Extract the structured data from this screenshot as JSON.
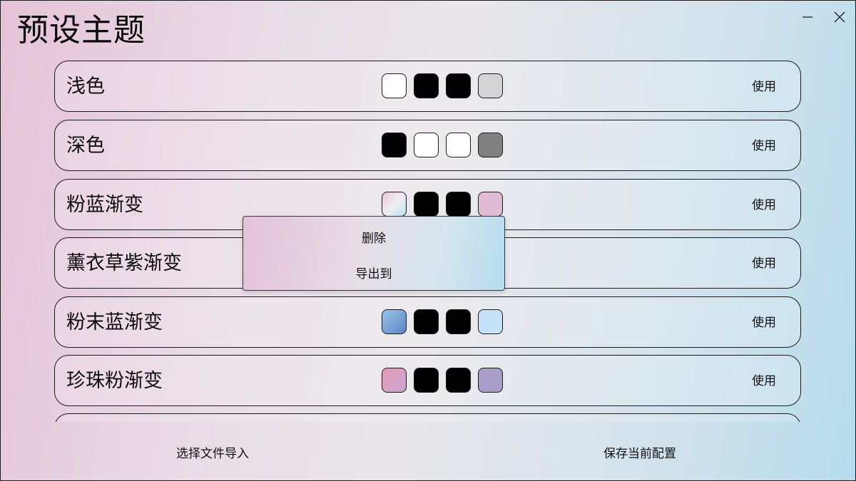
{
  "window": {
    "title": "预设主题",
    "controls": {
      "minimize": "minimize-icon",
      "close": "close-icon"
    }
  },
  "themes": [
    {
      "name": "浅色",
      "use_label": "使用",
      "swatches": [
        "#ffffff",
        "#000000",
        "#000000",
        "#d4d4d4"
      ]
    },
    {
      "name": "深色",
      "use_label": "使用",
      "swatches": [
        "#000000",
        "#ffffff",
        "#ffffff",
        "#808080"
      ]
    },
    {
      "name": "粉蓝渐变",
      "use_label": "使用",
      "swatches": [
        "linear-gradient(135deg,#e8c4d8,#f0eef2,#bfe0f0)",
        "#000000",
        "#000000",
        "#e2bcd6"
      ]
    },
    {
      "name": "薰衣草紫渐变",
      "use_label": "使用",
      "swatches": [
        "#d8c8e8",
        "#000000",
        "#000000",
        "#c8b0dc"
      ]
    },
    {
      "name": "粉末蓝渐变",
      "use_label": "使用",
      "swatches": [
        "linear-gradient(135deg,#9ec2e8,#5b86c8)",
        "#000000",
        "#000000",
        "#c6e2fb"
      ]
    },
    {
      "name": "珍珠粉渐变",
      "use_label": "使用",
      "swatches": [
        "linear-gradient(135deg,#e89aae,#c8a8d8)",
        "#000000",
        "#000000",
        "#a89cc8"
      ]
    },
    {
      "name": "",
      "use_label": "",
      "swatches": []
    }
  ],
  "context_menu": {
    "items": [
      "删除",
      "导出到"
    ]
  },
  "footer": {
    "import_label": "选择文件导入",
    "save_label": "保存当前配置"
  }
}
